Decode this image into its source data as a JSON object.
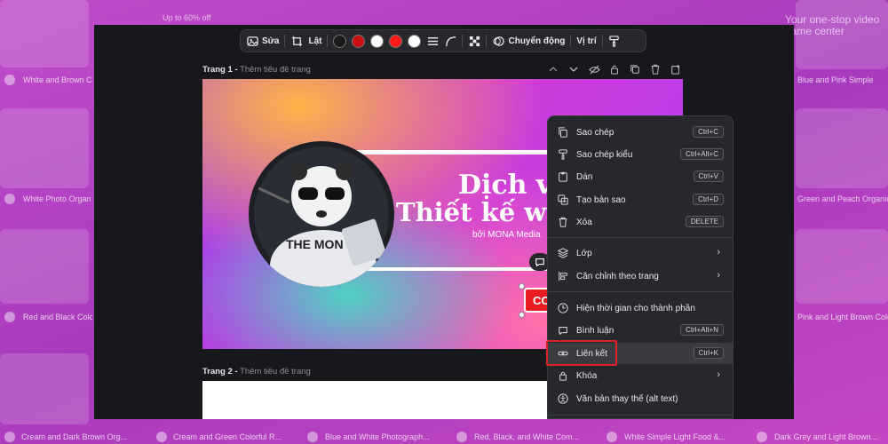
{
  "background": {
    "cards": [
      {
        "caption": "White and Brown C",
        "sub": ""
      },
      {
        "caption": "White Photo Organ",
        "sub": ""
      },
      {
        "caption": "Red and Black Colorf",
        "sub": ""
      },
      {
        "caption": "Cream and Dark Brown Org...",
        "sub": ""
      },
      {
        "caption": "Cream and Green Colorful R...",
        "sub": ""
      },
      {
        "caption": "Blue and White Photograph...",
        "sub": ""
      },
      {
        "caption": "Red, Black, and White Com...",
        "sub": ""
      },
      {
        "caption": "White Simple Light Food &...",
        "sub": ""
      },
      {
        "caption": "Dark Grey and Light Brown...",
        "sub": ""
      },
      {
        "caption": "Blue and Pink Simple",
        "sub": ""
      },
      {
        "caption": "Green and Peach Organic",
        "sub": ""
      },
      {
        "caption": "Pink and Light Brown Colorf",
        "sub": ""
      }
    ],
    "promo_left": "Up to 60% off",
    "promo_right": "Your one-stop video game center"
  },
  "toolbar": {
    "edit_label": "Sửa",
    "flip_label": "Lật",
    "animate_label": "Chuyển động",
    "position_label": "Vị trí",
    "swatches": [
      "#1a1a1a",
      "#d01010",
      "#ffffff",
      "#ff1a1a",
      "#ffffff"
    ]
  },
  "page1": {
    "label": "Trang 1",
    "sub": "Thêm tiêu đề trang",
    "headline1": "Dịch vụ",
    "headline2": "Thiết kế we",
    "byline": "bởi MONA Media",
    "badge_text": "THE MON",
    "cta_text": "CO"
  },
  "page2": {
    "label": "Trang 2",
    "sub": "Thêm tiêu đề trang"
  },
  "context_menu": {
    "items": [
      {
        "label": "Sao chép",
        "shortcut": "Ctrl+C",
        "icon": "copy-icon"
      },
      {
        "label": "Sao chép kiểu",
        "shortcut": "Ctrl+Alt+C",
        "icon": "paint-roller-icon"
      },
      {
        "label": "Dán",
        "shortcut": "Ctrl+V",
        "icon": "clipboard-icon"
      },
      {
        "label": "Tạo bản sao",
        "shortcut": "Ctrl+D",
        "icon": "duplicate-icon"
      },
      {
        "label": "Xóa",
        "shortcut": "DELETE",
        "icon": "trash-icon"
      },
      {
        "label": "Lớp",
        "shortcut": "",
        "icon": "layers-icon"
      },
      {
        "label": "Căn chỉnh theo trang",
        "shortcut": "",
        "icon": "align-icon"
      },
      {
        "label": "Hiện thời gian cho thành phần",
        "shortcut": "",
        "icon": "clock-icon"
      },
      {
        "label": "Bình luận",
        "shortcut": "Ctrl+Alt+N",
        "icon": "comment-icon"
      },
      {
        "label": "Liên kết",
        "shortcut": "Ctrl+K",
        "icon": "link-icon"
      },
      {
        "label": "Khóa",
        "shortcut": "",
        "icon": "lock-icon"
      },
      {
        "label": "Văn bản thay thế (alt text)",
        "shortcut": "",
        "icon": "accessibility-icon"
      }
    ]
  },
  "colors": {
    "highlight_box": "#e02424",
    "menu_bg": "#26282d",
    "editor_bg": "#16181c"
  }
}
